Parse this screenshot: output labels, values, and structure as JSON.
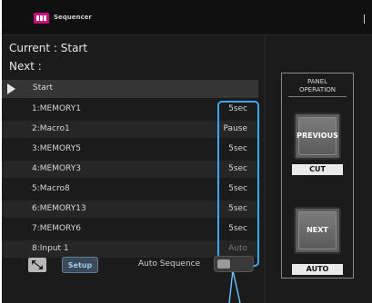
{
  "app": {
    "title": "Sequencer"
  },
  "status": {
    "current": "Current : Start",
    "next": "Next    :"
  },
  "list": {
    "header": "Start",
    "rows": [
      {
        "name": "1:MEMORY1",
        "time": "5sec"
      },
      {
        "name": "2:Macro1",
        "time": "Pause"
      },
      {
        "name": "3:MEMORY5",
        "time": "5sec"
      },
      {
        "name": "4:MEMORY3",
        "time": "5sec"
      },
      {
        "name": "5:Macro8",
        "time": "5sec"
      },
      {
        "name": "6:MEMORY13",
        "time": "5sec"
      },
      {
        "name": "7:MEMORY6",
        "time": "5sec"
      },
      {
        "name": "8:Input 1",
        "time": "Auto"
      }
    ]
  },
  "bottom": {
    "setup_label": "Setup",
    "auto_sequence_label": "Auto Sequence"
  },
  "panel": {
    "title_line1": "PANEL",
    "title_line2": "OPERATION",
    "previous_label": "PREVIOUS",
    "cut_label": "CUT",
    "next_label": "NEXT",
    "auto_label": "AUTO"
  },
  "colors": {
    "highlight": "#3fa8e8",
    "logo": "#c8107d"
  }
}
